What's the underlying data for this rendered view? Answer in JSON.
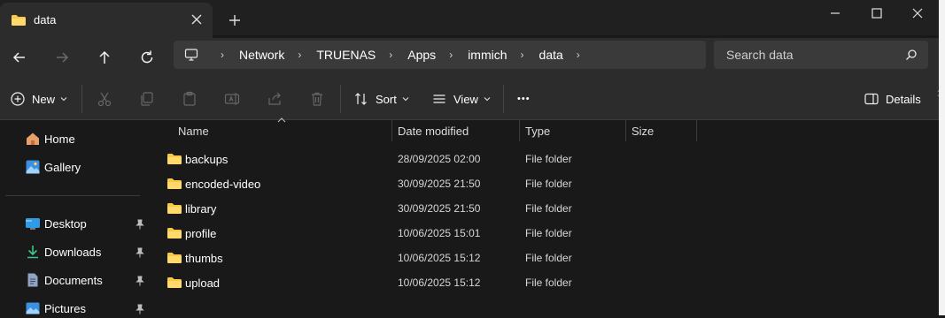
{
  "window": {
    "tab_title": "data",
    "new_tab_symbol": "+",
    "controls": [
      "minimize-icon",
      "maximize-icon",
      "close-icon"
    ]
  },
  "nav": {
    "breadcrumbs": [
      "Network",
      "TRUENAS",
      "Apps",
      "immich",
      "data"
    ],
    "search_placeholder": "Search data"
  },
  "toolbar": {
    "new_label": "New",
    "sort_label": "Sort",
    "view_label": "View",
    "more_label": "•••",
    "details_label": "Details",
    "overflow_glyph": ">"
  },
  "sidebar": {
    "items": [
      {
        "label": "Home",
        "icon": "home-icon"
      },
      {
        "label": "Gallery",
        "icon": "gallery-icon"
      },
      {
        "label": "Desktop",
        "icon": "desktop-icon",
        "pinned": true
      },
      {
        "label": "Downloads",
        "icon": "downloads-icon",
        "pinned": true
      },
      {
        "label": "Documents",
        "icon": "documents-icon",
        "pinned": true
      },
      {
        "label": "Pictures",
        "icon": "pictures-icon",
        "pinned": true
      }
    ]
  },
  "file_list": {
    "columns": [
      "Name",
      "Date modified",
      "Type",
      "Size"
    ],
    "rows": [
      {
        "name": "backups",
        "date": "28/09/2025 02:00",
        "type": "File folder"
      },
      {
        "name": "encoded-video",
        "date": "30/09/2025 21:50",
        "type": "File folder"
      },
      {
        "name": "library",
        "date": "30/09/2025 21:50",
        "type": "File folder"
      },
      {
        "name": "profile",
        "date": "10/06/2025 15:01",
        "type": "File folder"
      },
      {
        "name": "thumbs",
        "date": "10/06/2025 15:12",
        "type": "File folder"
      },
      {
        "name": "upload",
        "date": "10/06/2025 15:12",
        "type": "File folder"
      }
    ]
  },
  "colors": {
    "background": "#191919",
    "toolbar": "#2c2c2c",
    "folder": "#f7c948",
    "accent": "#4cc2ff"
  }
}
